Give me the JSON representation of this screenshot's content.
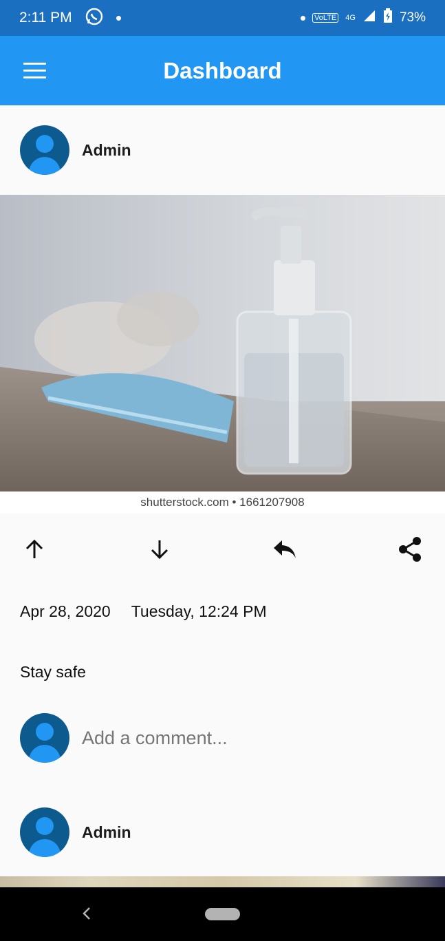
{
  "status_bar": {
    "time": "2:11 PM",
    "battery": "73%",
    "network": "4G"
  },
  "app_bar": {
    "title": "Dashboard"
  },
  "post": {
    "author": "Admin",
    "image_watermark": "shutterstock.com • 1661207908",
    "date": "Apr 28, 2020",
    "day_time": "Tuesday, 12:24 PM",
    "caption": "Stay safe",
    "comment_placeholder": "Add a comment..."
  },
  "next_post": {
    "author": "Admin"
  },
  "colors": {
    "status_bar": "#1a6fc1",
    "app_bar": "#2196f3",
    "avatar_bg": "#0d5a8e",
    "avatar_fg": "#2196f3"
  }
}
